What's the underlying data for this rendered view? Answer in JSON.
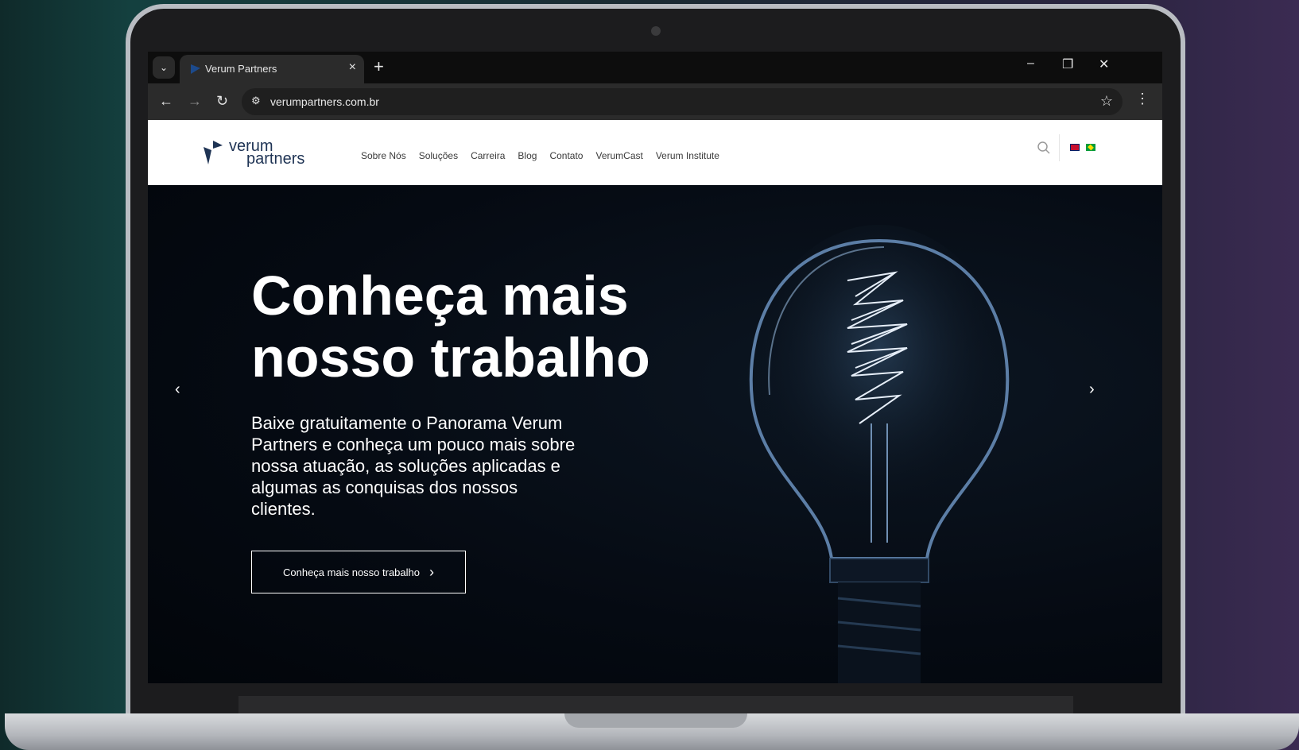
{
  "browser": {
    "tab_title": "Verum Partners",
    "url": "verumpartners.com.br",
    "new_tab": "+",
    "close_tab": "×",
    "minimize": "–",
    "restore": "❐",
    "close_window": "✕",
    "back": "←",
    "forward": "→",
    "reload": "↻",
    "star": "☆",
    "menu": "⋮",
    "tab_search": "⌄",
    "site_info": "⚙"
  },
  "site": {
    "logo_top": "verum",
    "logo_bottom": "partners",
    "nav": [
      "Sobre Nós",
      "Soluções",
      "Carreira",
      "Blog",
      "Contato",
      "VerumCast",
      "Verum Institute"
    ]
  },
  "hero": {
    "title_line1": "Conheça mais",
    "title_line2": "nosso trabalho",
    "description": "Baixe gratuitamente o Panorama Verum Partners e conheça um pouco mais sobre nossa atuação, as soluções aplicadas e algumas as conquisas dos nossos clientes.",
    "button_label": "Conheça mais nosso trabalho",
    "button_chevron": "›",
    "prev_arrow": "‹",
    "next_arrow": "›"
  }
}
